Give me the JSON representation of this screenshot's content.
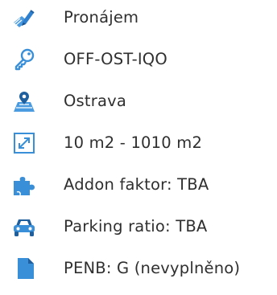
{
  "details": {
    "items": [
      {
        "icon": "pen-document-icon",
        "label": "Pronájem"
      },
      {
        "icon": "key-icon",
        "label": "OFF-OST-IQO"
      },
      {
        "icon": "map-location-icon",
        "label": "Ostrava"
      },
      {
        "icon": "resize-area-icon",
        "label": "10 m2 - 1010 m2"
      },
      {
        "icon": "puzzle-icon",
        "label": "Addon faktor: TBA"
      },
      {
        "icon": "car-icon",
        "label": "Parking ratio: TBA"
      },
      {
        "icon": "file-icon",
        "label": "PENB: G (nevyplněno)"
      }
    ]
  },
  "colors": {
    "icon_blue": "#3a8fd9",
    "icon_dark": "#1f5f9e",
    "text": "#2f2f2f"
  }
}
